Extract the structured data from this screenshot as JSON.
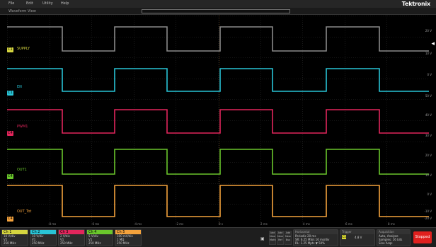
{
  "menubar": {
    "items": [
      {
        "label": "File"
      },
      {
        "label": "Edit"
      },
      {
        "label": "Utility"
      },
      {
        "label": "Help"
      }
    ],
    "brand": "Tektronix"
  },
  "view": {
    "title": "Waveform View"
  },
  "channels": [
    {
      "marker": "C1",
      "name": "SUPPLY",
      "color": "#d6d640"
    },
    {
      "marker": "C1",
      "name": "EN",
      "color": "#29c4d6"
    },
    {
      "marker": "C4",
      "name": "PWM1",
      "color": "#e2265c"
    },
    {
      "marker": "C4",
      "name": "OUT1",
      "color": "#6ac62c"
    },
    {
      "marker": "C4",
      "name": "OUT_Tot",
      "color": "#f4a23c"
    }
  ],
  "scale_labels": [
    "20 V",
    "10 V",
    "0 V",
    "50 V",
    "40 V",
    "30 V",
    "20 V",
    "10 V",
    "0 V",
    "-10 V",
    "-20 V"
  ],
  "time_ticks": [
    "-8 ms",
    "-6 ms",
    "-4 ms",
    "-2 ms",
    "0 s",
    "2 ms",
    "4 ms",
    "6 ms",
    "8 ms"
  ],
  "waveforms": {
    "color_supply_trace": "#8a8a8a",
    "note": ""
  },
  "bottom": {
    "channel_badges": [
      {
        "name": "Ch 1",
        "color": "#d6d640",
        "scale": "10 V/div",
        "offset": "V1",
        "bw": "250 MHz"
      },
      {
        "name": "Ch 2",
        "color": "#29c4d6",
        "scale": "10 V/div",
        "offset": "V1",
        "bw": "250 MHz"
      },
      {
        "name": "Ch 3",
        "color": "#e2265c",
        "scale": "2 V/div",
        "offset": "V1",
        "bw": "250 MHz"
      },
      {
        "name": "Ch 4",
        "color": "#6ac62c",
        "scale": "5 V/div",
        "offset": "V1",
        "bw": "250 MHz"
      },
      {
        "name": "Ch 5",
        "color": "#f4a23c",
        "scale": "100 mV/div",
        "offset": "1 MΩ",
        "bw": "250 MHz"
      }
    ],
    "acq_buttons": [
      "Add New Math",
      "Add New Ref",
      "Add New Bus"
    ],
    "horizontal": {
      "title": "Horizontal",
      "line1": "Periodic   20 ms",
      "line2": "SR: 6.25 MS/s   16 ms/div",
      "line3": "RL: 1.25 Mpts   ▼ 50%"
    },
    "trigger": {
      "title": "Trigger",
      "source": "C1",
      "level": "4.8 V"
    },
    "acquisition": {
      "title": "Acquisition",
      "line1": "Auto,   Analyze",
      "line2": "Samples: 16 bits",
      "line3": "Sine Acqs"
    },
    "stop_label": "Stopped"
  }
}
